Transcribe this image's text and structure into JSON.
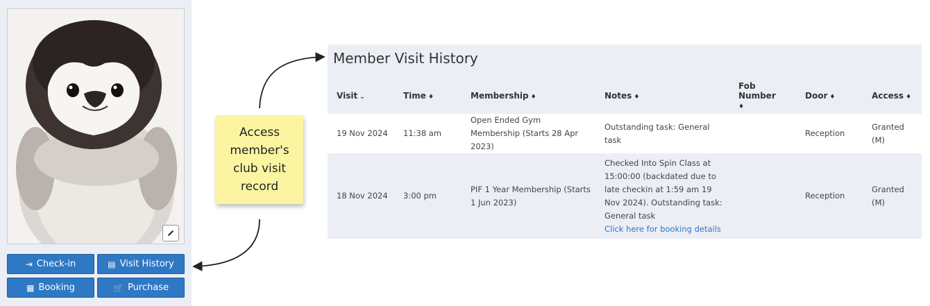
{
  "member_panel": {
    "buttons": {
      "checkin": {
        "icon": "check-in-icon",
        "label": "Check-in"
      },
      "visit_history": {
        "icon": "visit-history-icon",
        "label": "Visit History"
      },
      "booking": {
        "icon": "calendar-icon",
        "label": "Booking"
      },
      "purchase": {
        "icon": "cart-icon",
        "label": "Purchase"
      }
    },
    "edit_icon": "pencil-icon"
  },
  "annotation": {
    "note_lines": [
      "Access",
      "member's",
      "club visit",
      "record"
    ]
  },
  "visit_history": {
    "title": "Member Visit History",
    "columns": [
      {
        "label": "Visit",
        "sort": "⌄"
      },
      {
        "label": "Time",
        "sort": "♦"
      },
      {
        "label": "Membership",
        "sort": "♦"
      },
      {
        "label": "Notes",
        "sort": "♦"
      },
      {
        "label": "Fob Number",
        "sort": "♦"
      },
      {
        "label": "Door",
        "sort": "♦"
      },
      {
        "label": "Access",
        "sort": "♦"
      }
    ],
    "rows": [
      {
        "visit": "19 Nov 2024",
        "time": "11:38 am",
        "membership": "Open Ended Gym Membership (Starts 28 Apr 2023)",
        "notes": "Outstanding task: General task",
        "notes_link": "",
        "fob": "",
        "door": "Reception",
        "access": "Granted (M)"
      },
      {
        "visit": "18 Nov 2024",
        "time": "3:00 pm",
        "membership": "PIF 1 Year Membership (Starts 1 Jun 2023)",
        "notes": "Checked Into Spin Class at 15:00:00 (backdated due to late checkin at 1:59 am 19 Nov 2024). Outstanding task: General task",
        "notes_link": "Click here for booking details",
        "fob": "",
        "door": "Reception",
        "access": "Granted (M)"
      }
    ]
  },
  "colors": {
    "button_blue": "#2f78c4",
    "panel_bg": "#eceef5",
    "sticky_yellow": "#fbf5a1",
    "link_blue": "#2a79c6"
  }
}
